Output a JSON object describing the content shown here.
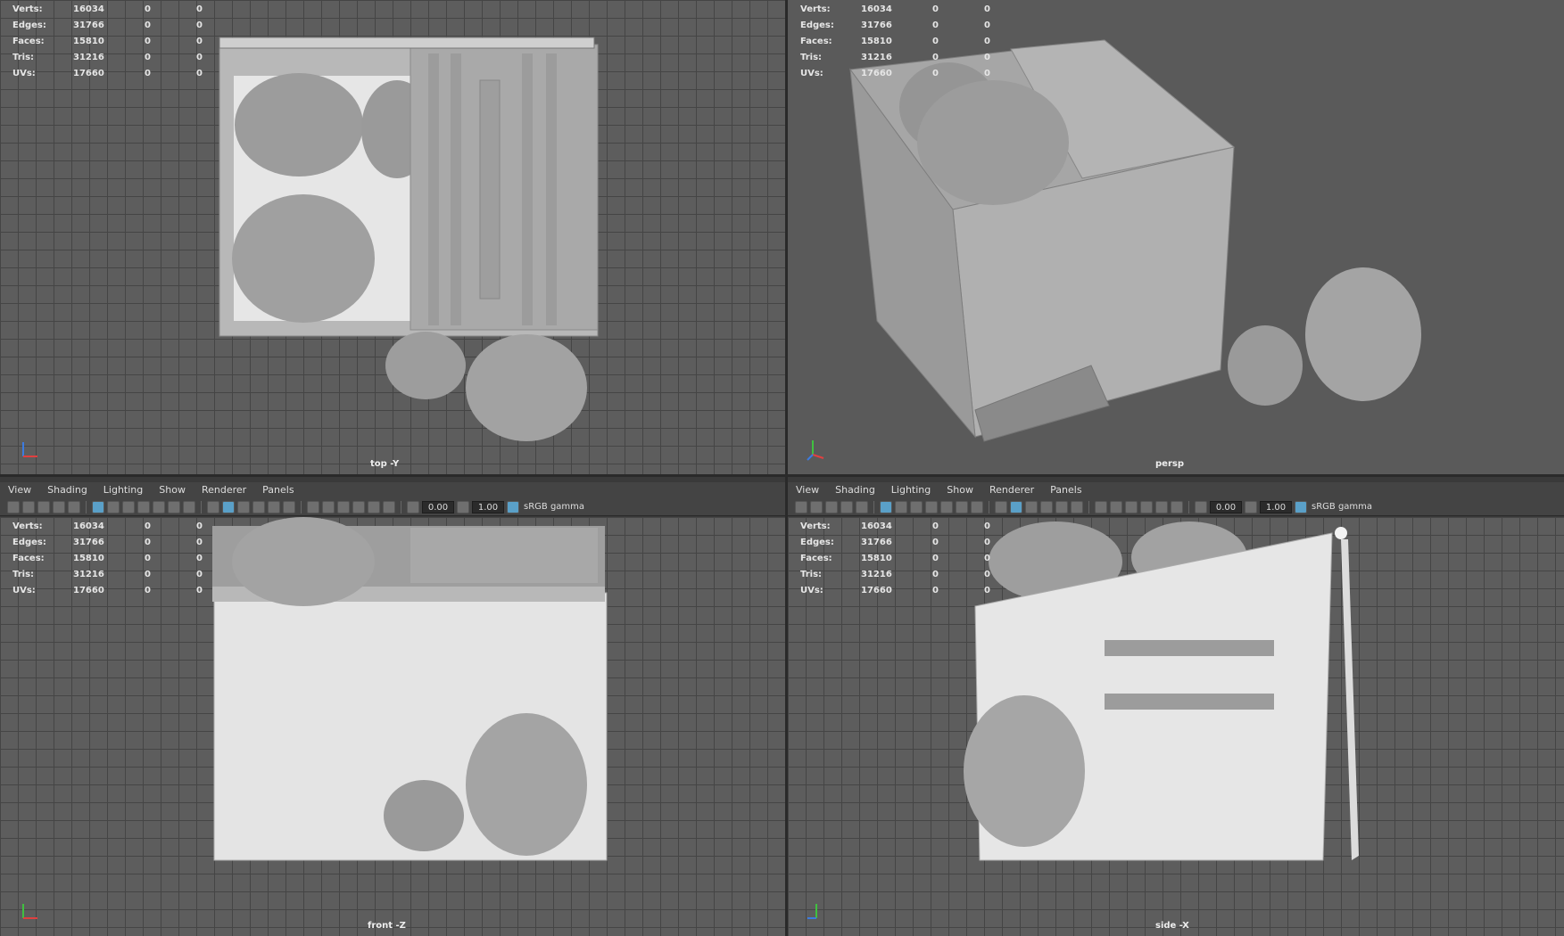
{
  "hud": {
    "rows": [
      {
        "label": "Verts:",
        "v1": "16034",
        "v2": "0",
        "v3": "0"
      },
      {
        "label": "Edges:",
        "v1": "31766",
        "v2": "0",
        "v3": "0"
      },
      {
        "label": "Faces:",
        "v1": "15810",
        "v2": "0",
        "v3": "0"
      },
      {
        "label": "Tris:",
        "v1": "31216",
        "v2": "0",
        "v3": "0"
      },
      {
        "label": "UVs:",
        "v1": "17660",
        "v2": "0",
        "v3": "0"
      }
    ]
  },
  "viewports": {
    "top": {
      "label": "top -Y"
    },
    "persp": {
      "label": "persp"
    },
    "front": {
      "label": "front -Z"
    },
    "side": {
      "label": "side -X"
    }
  },
  "panel_menu": {
    "view": "View",
    "shading": "Shading",
    "lighting": "Lighting",
    "show": "Show",
    "renderer": "Renderer",
    "panels": "Panels"
  },
  "panel_toolbar": {
    "exposure": "0.00",
    "gamma": "1.00",
    "color_space": "sRGB gamma"
  },
  "colors": {
    "viewport_bg": "#5d5d5d",
    "grid_line": "#454545",
    "model": "#a8a8a8",
    "accent": "#5aa0c8"
  }
}
